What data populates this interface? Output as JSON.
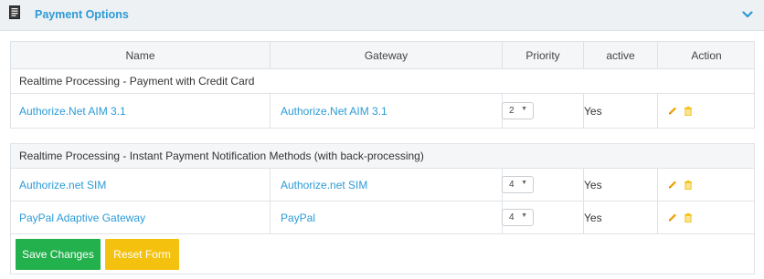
{
  "panel": {
    "title": "Payment Options"
  },
  "table": {
    "headers": {
      "name": "Name",
      "gateway": "Gateway",
      "priority": "Priority",
      "active": "active",
      "action": "Action"
    },
    "groups": [
      {
        "title": "Realtime Processing - Payment with Credit Card",
        "rows": [
          {
            "name": "Authorize.Net AIM 3.1",
            "gateway": "Authorize.Net AIM 3.1",
            "priority": "2",
            "active": "Yes"
          }
        ]
      },
      {
        "title": "Realtime Processing - Instant Payment Notification Methods (with back-processing)",
        "rows": [
          {
            "name": "Authorize.net SIM",
            "gateway": "Authorize.net SIM",
            "priority": "4",
            "active": "Yes"
          },
          {
            "name": "PayPal Adaptive Gateway",
            "gateway": "PayPal",
            "priority": "4",
            "active": "Yes"
          }
        ]
      }
    ]
  },
  "buttons": {
    "save": "Save Changes",
    "reset": "Reset Form"
  },
  "colors": {
    "link": "#2c9bd6",
    "save": "#22b14c",
    "reset": "#f4c10f",
    "edit_icon": "#f0a30a",
    "delete_icon": "#f4c10f"
  },
  "icons": {
    "panel": "document-icon",
    "collapse": "chevron-down-icon",
    "edit": "pencil-icon",
    "delete": "trash-icon",
    "select_arrow": "caret-down-icon"
  }
}
